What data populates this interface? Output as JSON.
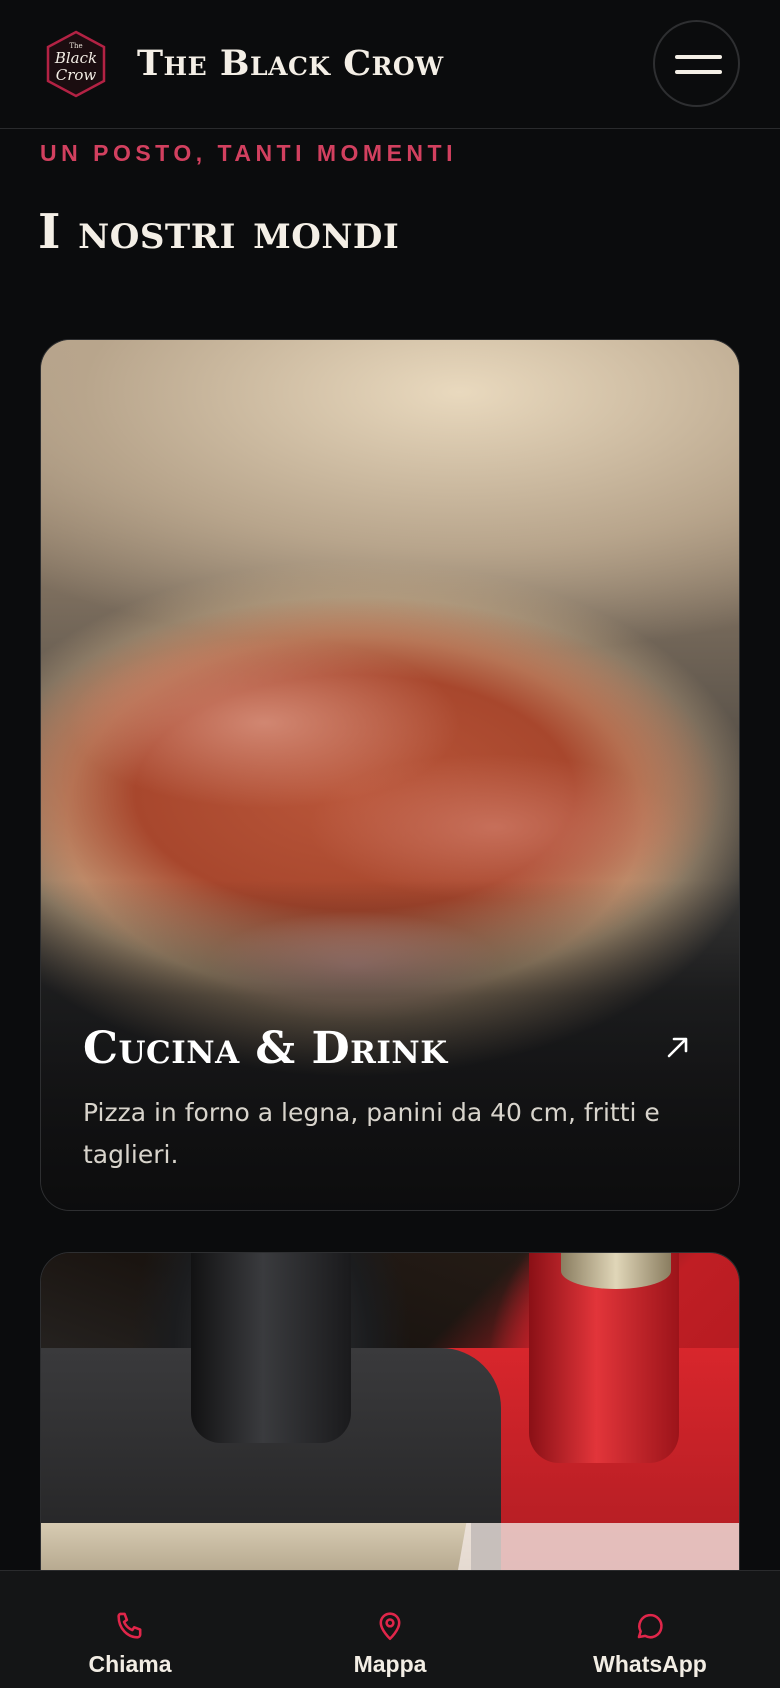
{
  "theme": {
    "accent": "#d2405f",
    "icon_red": "#e0264a",
    "background": "#0b0c0d",
    "text": "#f2ede4"
  },
  "header": {
    "logo_text_small": "The",
    "logo_text_line1": "Black",
    "logo_text_line2": "Crow",
    "brand": "The Black Crow",
    "menu_icon": "hamburger-icon"
  },
  "section": {
    "eyebrow": "UN POSTO, TANTI MOMENTI",
    "title": "I nostri mondi"
  },
  "cards": [
    {
      "title": "Cucina & Drink",
      "description": "Pizza in forno a legna, panini da 40 cm, fritti e taglieri.",
      "icon": "arrow-up-right-icon"
    },
    {
      "image": "beer-taps"
    }
  ],
  "bottom_nav": [
    {
      "label": "Chiama",
      "icon": "phone-icon"
    },
    {
      "label": "Mappa",
      "icon": "map-pin-icon"
    },
    {
      "label": "WhatsApp",
      "icon": "chat-bubble-icon"
    }
  ]
}
